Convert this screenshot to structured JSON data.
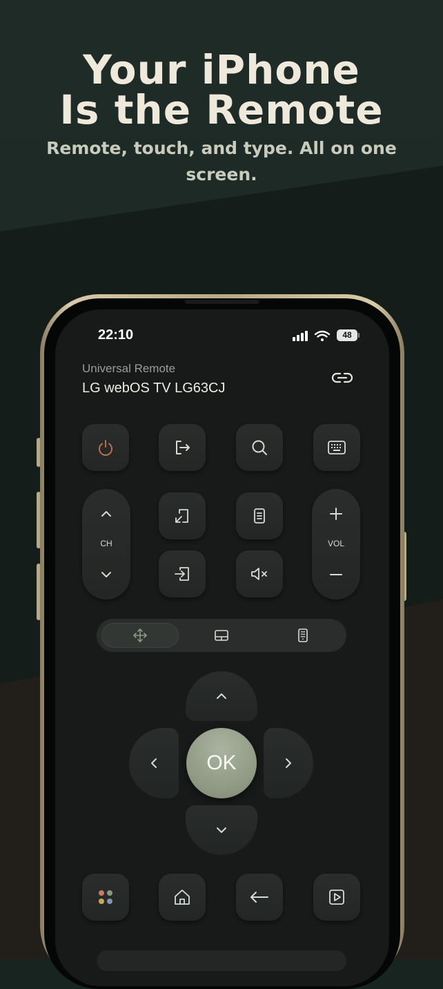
{
  "headline": {
    "line1": "Your iPhone",
    "line2": "Is the Remote",
    "sub_line1": "Remote, touch, and type. All on one",
    "sub_line2": "screen."
  },
  "status_bar": {
    "time": "22:10",
    "battery": "48"
  },
  "header": {
    "subtitle": "Universal Remote",
    "device_name": "LG webOS TV LG63CJ"
  },
  "channel": {
    "label": "CH"
  },
  "volume": {
    "label": "VOL"
  },
  "ok_label": "OK",
  "colors": {
    "power_icon": "#b86f52",
    "accent_ok": "#8d9883",
    "headline_text": "#efe9dc",
    "icon": "#d9dbd5"
  },
  "icons": {
    "row1": [
      "power-icon",
      "exit-icon",
      "search-icon",
      "keyboard-icon"
    ],
    "row2": [
      "source-icon",
      "info-icon"
    ],
    "row3": [
      "input-icon",
      "mute-icon"
    ],
    "mode_tabs": [
      "move-icon",
      "touchpad-icon",
      "numpad-icon"
    ],
    "bottom_row": [
      "apps-icon",
      "home-icon",
      "back-icon",
      "play-icon"
    ]
  }
}
